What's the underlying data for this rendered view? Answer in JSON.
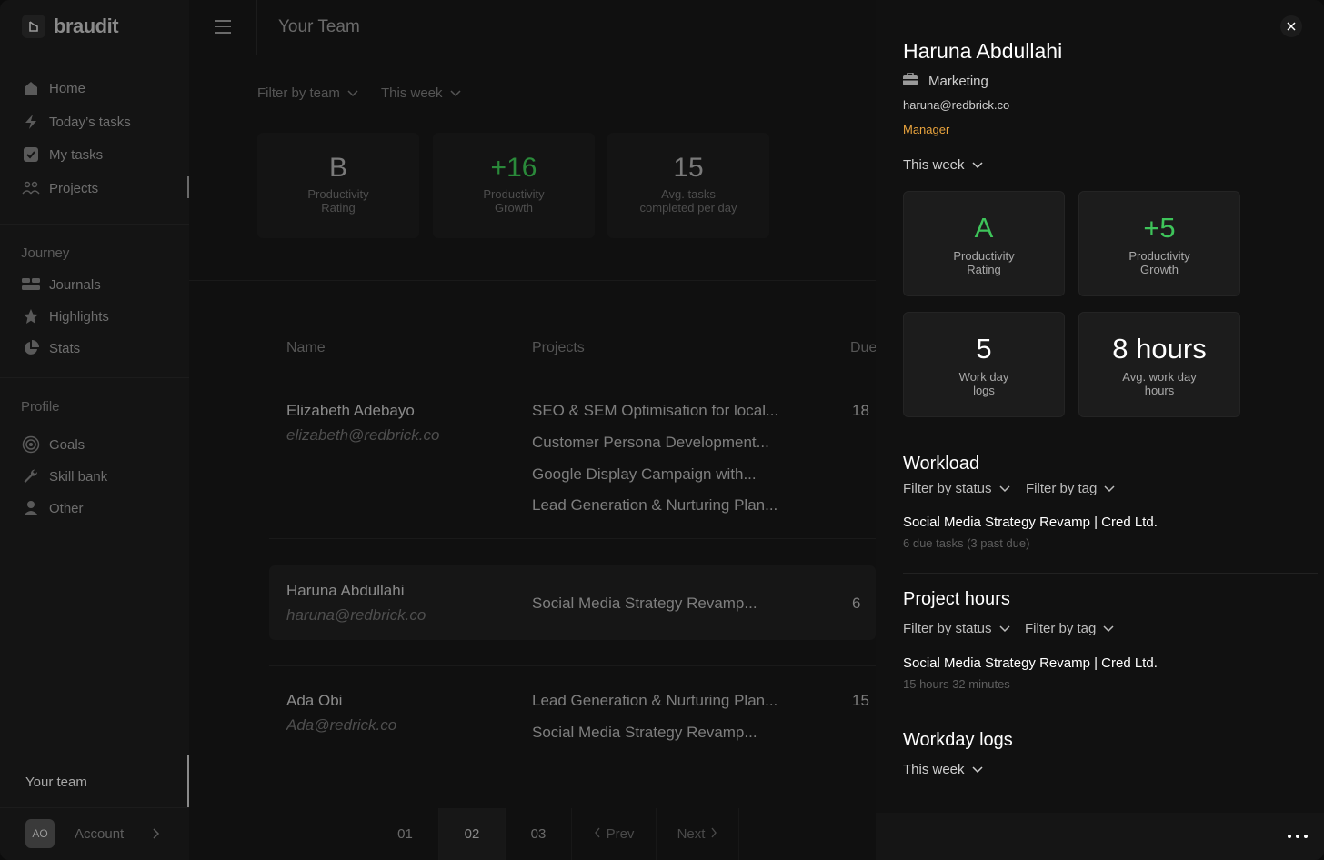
{
  "app": {
    "logo_text": "braudit",
    "page_title": "Your Team"
  },
  "sidebar": {
    "main_items": [
      {
        "label": "Home",
        "icon": "home-icon"
      },
      {
        "label": "Today’s tasks",
        "icon": "bolt-icon"
      },
      {
        "label": "My tasks",
        "icon": "checkbox-icon"
      },
      {
        "label": "Projects",
        "icon": "people-icon"
      }
    ],
    "journey_label": "Journey",
    "journey_items": [
      {
        "label": "Journals",
        "icon": "journals-icon"
      },
      {
        "label": "Highlights",
        "icon": "star-icon"
      },
      {
        "label": "Stats",
        "icon": "pie-chart-icon"
      }
    ],
    "profile_label": "Profile",
    "profile_items": [
      {
        "label": "Goals",
        "icon": "target-icon"
      },
      {
        "label": "Skill bank",
        "icon": "wrench-icon"
      },
      {
        "label": "Other",
        "icon": "user-icon"
      }
    ],
    "your_team": "Your team",
    "account": {
      "initials": "AO",
      "label": "Account"
    }
  },
  "main": {
    "filter_team": "Filter by team",
    "filter_period": "This week",
    "stats": [
      {
        "value": "B",
        "label_1": "Productivity",
        "label_2": "Rating"
      },
      {
        "value": "+16",
        "label_1": "Productivity",
        "label_2": "Growth"
      },
      {
        "value": "15",
        "label_1": "Avg. tasks",
        "label_2": "completed per day"
      }
    ],
    "table": {
      "headers": {
        "name": "Name",
        "projects": "Projects",
        "due": "Due"
      },
      "rows": [
        {
          "name": "Elizabeth Adebayo",
          "email": "elizabeth@redbrick.co",
          "projects": [
            "SEO & SEM Optimisation for local...",
            "Customer Persona Development...",
            "Google Display Campaign with...",
            "Lead Generation & Nurturing Plan..."
          ],
          "due": "18"
        },
        {
          "name": "Haruna Abdullahi",
          "email": "haruna@redbrick.co",
          "projects": [
            "Social Media Strategy Revamp..."
          ],
          "due": "6"
        },
        {
          "name": "Ada Obi",
          "email": "Ada@redrick.co",
          "projects": [
            "Lead Generation & Nurturing Plan...",
            "Social Media Strategy Revamp..."
          ],
          "due": "15"
        }
      ]
    },
    "pagination": {
      "pages": [
        "01",
        "02",
        "03"
      ],
      "active": "02",
      "prev": "Prev",
      "next": "Next"
    }
  },
  "panel": {
    "name": "Haruna Abdullahi",
    "department": "Marketing",
    "email": "haruna@redbrick.co",
    "role": "Manager",
    "period": "This week",
    "cards": [
      {
        "value": "A",
        "label_1": "Productivity",
        "label_2": "Rating"
      },
      {
        "value": "+5",
        "label_1": "Productivity",
        "label_2": "Growth"
      },
      {
        "value": "5",
        "label_1": "Work day",
        "label_2": "logs"
      },
      {
        "value": "8 hours",
        "label_1": "Avg. work day",
        "label_2": "hours"
      }
    ],
    "workload": {
      "title": "Workload",
      "filter_status": "Filter by status",
      "filter_tag": "Filter by tag",
      "item": "Social Media Strategy Revamp | Cred Ltd.",
      "sub": "6 due tasks (3 past due)"
    },
    "project_hours": {
      "title": "Project hours",
      "filter_status": "Filter by status",
      "filter_tag": "Filter by tag",
      "item": "Social Media Strategy Revamp | Cred Ltd.",
      "sub": "15 hours 32 minutes"
    },
    "workday_logs": {
      "title": "Workday logs",
      "period": "This week"
    }
  },
  "colors": {
    "accent_green": "#3ec45a",
    "role_orange": "#e8a33d",
    "background": "#101010"
  }
}
